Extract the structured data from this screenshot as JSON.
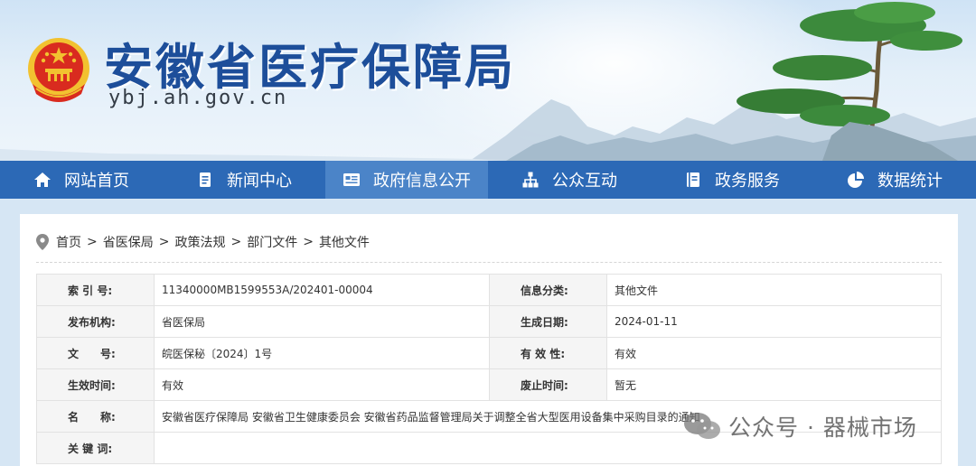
{
  "header": {
    "title": "安徽省医疗保障局",
    "domain": "ybj.ah.gov.cn"
  },
  "nav": {
    "items": [
      {
        "label": "网站首页",
        "icon": "home-icon"
      },
      {
        "label": "新闻中心",
        "icon": "document-icon"
      },
      {
        "label": "政府信息公开",
        "icon": "newspaper-icon",
        "active": true
      },
      {
        "label": "公众互动",
        "icon": "network-icon"
      },
      {
        "label": "政务服务",
        "icon": "book-icon"
      },
      {
        "label": "数据统计",
        "icon": "pie-chart-icon"
      }
    ]
  },
  "breadcrumb": {
    "icon": "location-pin-icon",
    "items": [
      "首页",
      "省医保局",
      "政策法规",
      "部门文件",
      "其他文件"
    ],
    "separator": ">"
  },
  "info": {
    "index_label": "索 引 号:",
    "index_value": "11340000MB1599553A/202401-00004",
    "category_label": "信息分类:",
    "category_value": "其他文件",
    "publisher_label": "发布机构:",
    "publisher_value": "省医保局",
    "date_label": "生成日期:",
    "date_value": "2024-01-11",
    "docno_label": "文　　号:",
    "docno_value": "皖医保秘〔2024〕1号",
    "validity_label": "有 效 性:",
    "validity_value": "有效",
    "effective_label": "生效时间:",
    "effective_value": "有效",
    "expire_label": "废止时间:",
    "expire_value": "暂无",
    "name_label": "名　　称:",
    "name_value": "安徽省医疗保障局 安徽省卫生健康委员会 安徽省药品监督管理局关于调整全省大型医用设备集中采购目录的通知",
    "keywords_label": "关 键 词:",
    "keywords_value": ""
  },
  "watermark": {
    "text": "公众号 · 器械市场",
    "icon": "wechat-icon"
  },
  "colors": {
    "nav_bg": "#2c69b6",
    "nav_active": "#4b84c8",
    "title_blue": "#1d4e9a",
    "emblem_red": "#d92b1f",
    "emblem_gold": "#f2c230"
  }
}
